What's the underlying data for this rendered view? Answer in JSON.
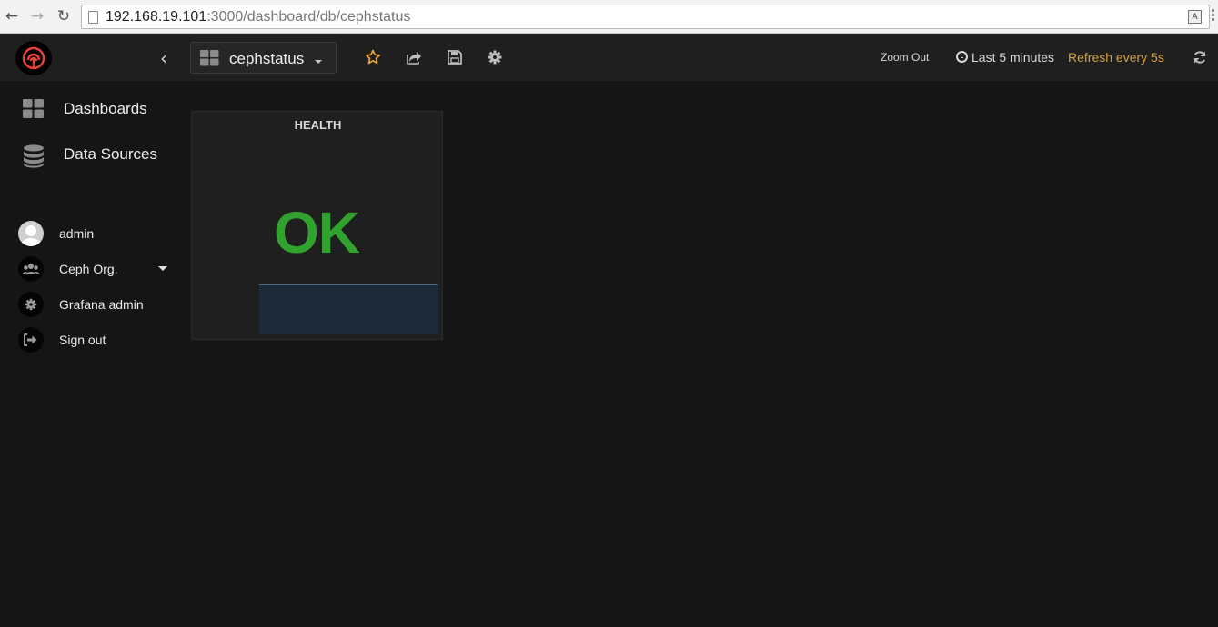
{
  "browser": {
    "url_host": "192.168.19.101",
    "url_rest": ":3000/dashboard/db/cephstatus"
  },
  "sidebar": {
    "items": [
      {
        "label": "Dashboards",
        "icon": "dashboards-grid-icon"
      },
      {
        "label": "Data Sources",
        "icon": "database-icon"
      }
    ],
    "user": {
      "name": "admin",
      "org": "Ceph Org.",
      "grafana_admin": "Grafana admin",
      "sign_out": "Sign out"
    }
  },
  "topnav": {
    "dashboard_title": "cephstatus",
    "zoom_out": "Zoom Out",
    "time_range": "Last 5 minutes",
    "refresh": "Refresh every 5s"
  },
  "panel": {
    "title": "HEALTH",
    "value": "OK"
  },
  "colors": {
    "ok_green": "#32a22f",
    "refresh_orange": "#d2a23f",
    "star_orange": "#e8a33a",
    "logo_red": "#e8403b"
  }
}
